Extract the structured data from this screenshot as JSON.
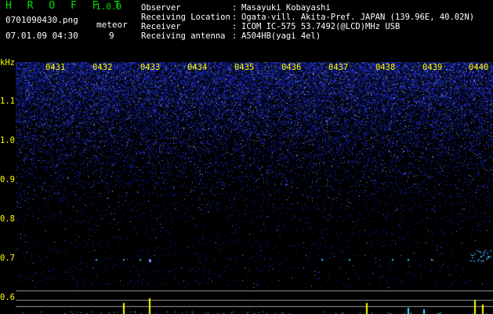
{
  "header": {
    "app_name": "H R O F F T",
    "app_version": "1.0.0",
    "file_name": "0701090430.png",
    "timestamp": "07.01.09 04:30",
    "meteor_label": "meteor",
    "meteor_count": "9"
  },
  "info": [
    {
      "key": "Observer",
      "sep": ":",
      "value": "Masayuki Kobayashi"
    },
    {
      "key": "Receiving Location",
      "sep": ":",
      "value": "Ogata-vill. Akita-Pref. JAPAN (139.96E, 40.02N)"
    },
    {
      "key": "Receiver",
      "sep": ":",
      "value": "ICOM IC-575 53.7492(@LCD)MHz USB"
    },
    {
      "key": "Receiving antenna",
      "sep": ":",
      "value": "A504HB(yagi 4el)"
    }
  ],
  "axis": {
    "unit": "kHz",
    "time_ticks": [
      "0431",
      "0432",
      "0433",
      "0434",
      "0435",
      "0436",
      "0437",
      "0438",
      "0439",
      "0440"
    ],
    "freq_ticks": [
      "1.1",
      "1.0",
      "0.9",
      "0.8",
      "0.7",
      "0.6"
    ]
  },
  "colors": {
    "accent_green": "#00e000",
    "label_yellow": "#ffff00",
    "noise_blue": "#2a3cff",
    "meteor_cyan": "#40c0ff"
  }
}
